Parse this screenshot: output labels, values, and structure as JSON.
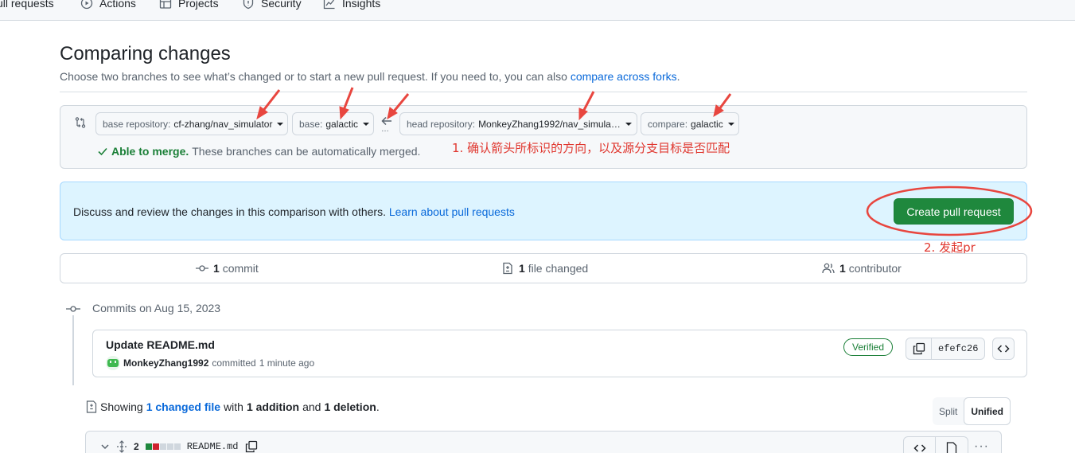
{
  "nav": {
    "items": [
      {
        "label": "ull requests",
        "icon": "pull-request-icon"
      },
      {
        "label": "Actions",
        "icon": "play-icon"
      },
      {
        "label": "Projects",
        "icon": "table-icon"
      },
      {
        "label": "Security",
        "icon": "shield-icon"
      },
      {
        "label": "Insights",
        "icon": "graph-icon"
      }
    ]
  },
  "header": {
    "title": "Comparing changes",
    "subtitle": "Choose two branches to see what’s changed or to start a new pull request. If you need to, you can also",
    "subtitle_link": "compare across forks",
    "subtitle_end": "."
  },
  "range": {
    "base_repo_label": "base repository:",
    "base_repo_value": "cf-zhang/nav_simulator",
    "base_label": "base:",
    "base_value": "galactic",
    "head_repo_label": "head repository:",
    "head_repo_value": "MonkeyZhang1992/nav_simula…",
    "compare_label": "compare:",
    "compare_value": "galactic",
    "dots": "…",
    "merge_status": "Able to merge.",
    "merge_desc": "These branches can be automatically merged."
  },
  "annotations": {
    "note1": "1. 确认箭头所标识的方向，以及源分支目标是否匹配",
    "note2": "2. 发起pr",
    "color": "#e0372f"
  },
  "flash": {
    "text": "Discuss and review the changes in this comparison with others.",
    "link": "Learn about pull requests",
    "button": "Create pull request"
  },
  "stats": {
    "commits_count": "1",
    "commits_label": "commit",
    "files_count": "1",
    "files_label": "file changed",
    "contributors_count": "1",
    "contributors_label": "contributor"
  },
  "timeline": {
    "date": "Commits on Aug 15, 2023",
    "commit": {
      "title": "Update README.md",
      "author": "MonkeyZhang1992",
      "action": "committed",
      "time": "1 minute ago",
      "badge": "Verified",
      "sha": "efefc26"
    }
  },
  "diff": {
    "showing": "Showing",
    "changed_files": "1 changed file",
    "with": "with",
    "additions": "1 addition",
    "and": "and",
    "deletions": "1 deletion",
    "end": ".",
    "split": "Split",
    "unified": "Unified",
    "file": {
      "count": "2",
      "name": "README.md"
    }
  },
  "colors": {
    "accent": "#0969da",
    "success": "#1a7f37",
    "button": "#1f883d",
    "flash_bg": "#ddf4ff"
  }
}
